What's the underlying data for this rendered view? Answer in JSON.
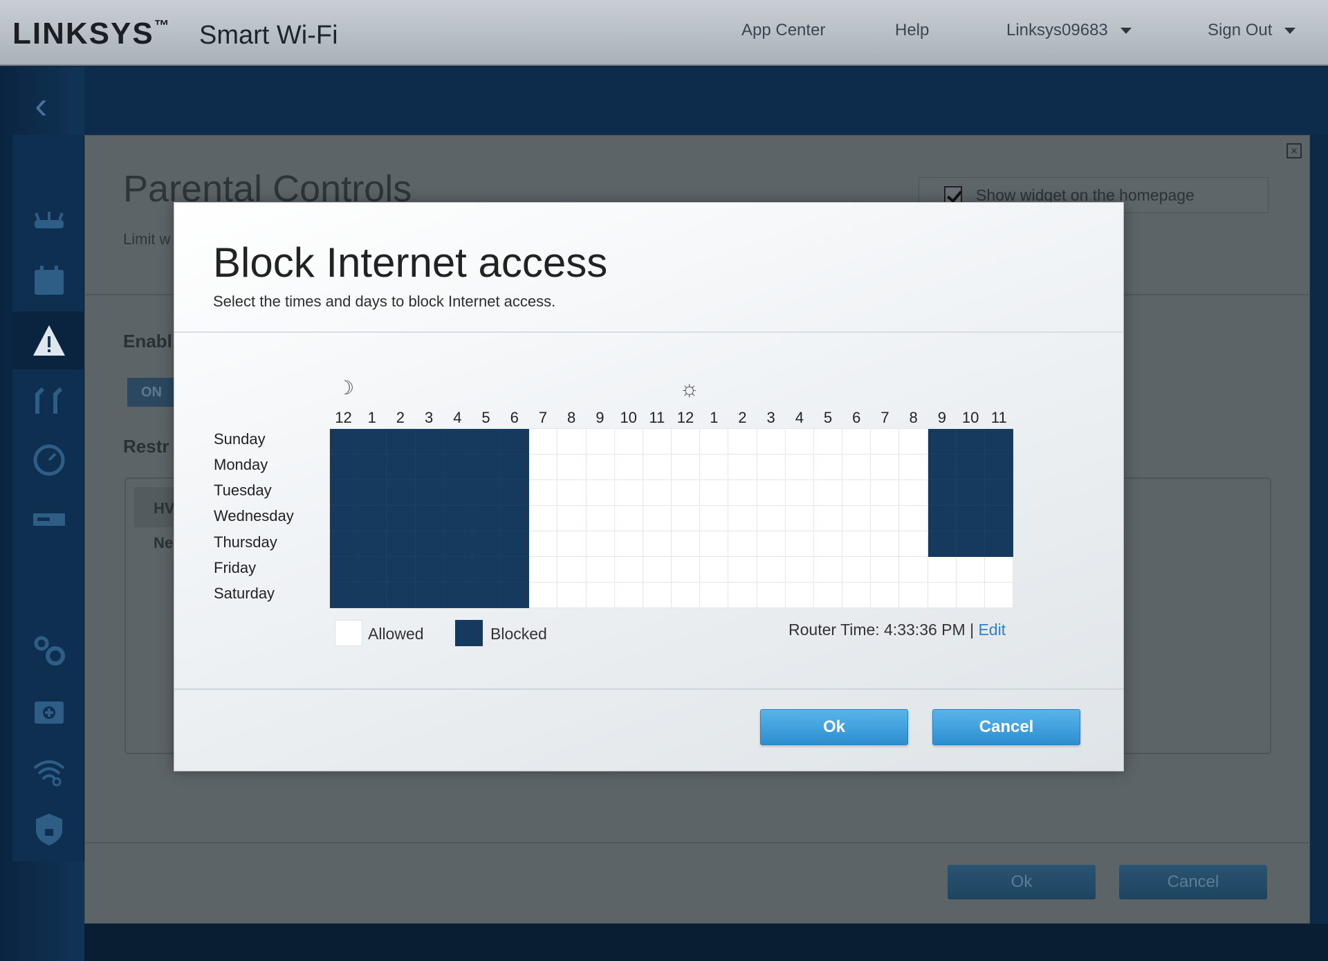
{
  "header": {
    "logo": "LINKSYS",
    "logo_tm": "™",
    "product": "Smart Wi-Fi",
    "nav": [
      "App Center",
      "Help",
      "Linksys09683",
      "Sign Out"
    ]
  },
  "sidebar": {
    "icons": [
      "router-icon",
      "calendar-icon",
      "parental-controls-icon",
      "media-prioritization-icon",
      "speed-test-icon",
      "external-storage-icon",
      "settings-icon",
      "troubleshooting-icon",
      "wireless-icon",
      "security-icon"
    ]
  },
  "background_panel": {
    "title": "Parental Controls",
    "subtitle": "Limit w",
    "widget_label": "Show widget on the homepage",
    "enable_label": "Enabl",
    "toggle_label": "ON",
    "restrict_label": "Restr",
    "list_header": "HV",
    "list_row": "Ne",
    "ok_label": "Ok",
    "cancel_label": "Cancel"
  },
  "modal": {
    "title": "Block Internet access",
    "subtitle": "Select the times and days to block Internet access.",
    "moon_glyph": "☽",
    "sun_glyph": "☼",
    "hours": [
      "12",
      "1",
      "2",
      "3",
      "4",
      "5",
      "6",
      "7",
      "8",
      "9",
      "10",
      "11",
      "12",
      "1",
      "2",
      "3",
      "4",
      "5",
      "6",
      "7",
      "8",
      "9",
      "10",
      "11"
    ],
    "days": [
      "Sunday",
      "Monday",
      "Tuesday",
      "Wednesday",
      "Thursday",
      "Friday",
      "Saturday"
    ],
    "blocked_ranges": [
      {
        "days": [
          0,
          1,
          2,
          3,
          4,
          5,
          6
        ],
        "hours": [
          0,
          1,
          2,
          3,
          4,
          5,
          6
        ]
      },
      {
        "days": [
          0,
          1,
          2,
          3,
          4
        ],
        "hours": [
          21,
          22,
          23
        ]
      }
    ],
    "legend_allowed": "Allowed",
    "legend_blocked": "Blocked",
    "router_time_label": "Router Time: 4:33:36 PM |",
    "edit_link": "Edit",
    "ok_label": "Ok",
    "cancel_label": "Cancel"
  },
  "colors": {
    "blocked": "#163a5e",
    "allowed": "#ffffff",
    "button": "#3a9ede",
    "link": "#2f7fc7"
  }
}
